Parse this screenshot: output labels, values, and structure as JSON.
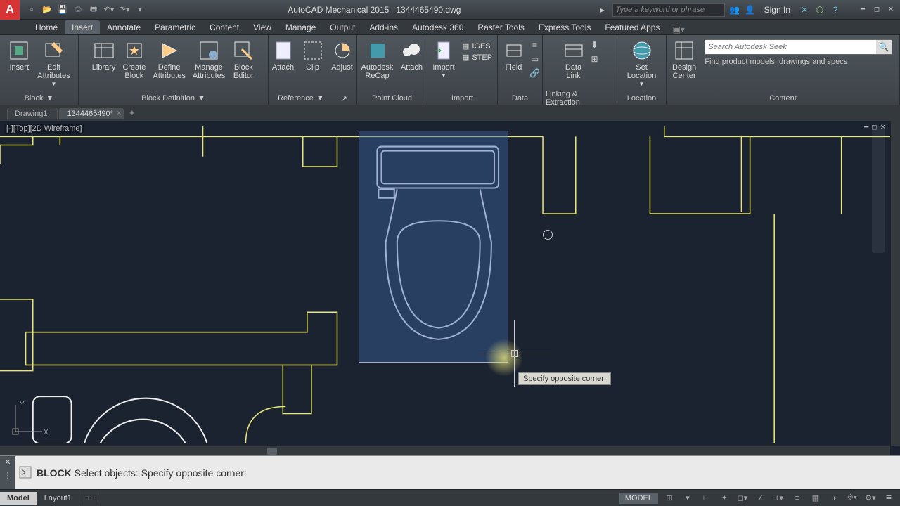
{
  "app": {
    "title_prefix": "AutoCAD Mechanical 2015",
    "filename": "1344465490.dwg"
  },
  "search": {
    "placeholder": "Type a keyword or phrase"
  },
  "signin": {
    "label": "Sign In"
  },
  "tabs": [
    "Home",
    "Insert",
    "Annotate",
    "Parametric",
    "Content",
    "View",
    "Manage",
    "Output",
    "Add-ins",
    "Autodesk 360",
    "Raster Tools",
    "Express Tools",
    "Featured Apps"
  ],
  "tabs_active": 1,
  "ribbon": {
    "panel1": {
      "insert": "Insert",
      "edit_attr": "Edit\nAttributes",
      "title": "Block"
    },
    "panel2": {
      "library": "Library",
      "create": "Create\nBlock",
      "define": "Define\nAttributes",
      "manage": "Manage\nAttributes",
      "editor": "Block\nEditor",
      "title": "Block Definition"
    },
    "panel3": {
      "attach": "Attach",
      "clip": "Clip",
      "adjust": "Adjust",
      "title": "Reference"
    },
    "panel4": {
      "recap": "Autodesk\nReCap",
      "attach": "Attach",
      "title": "Point Cloud"
    },
    "panel5": {
      "import": "Import",
      "iges": "IGES",
      "step": "STEP",
      "title": "Import"
    },
    "panel6": {
      "field": "Field",
      "title": "Data"
    },
    "panel7": {
      "datalink": "Data\nLink",
      "title": "Linking & Extraction"
    },
    "panel8": {
      "setloc": "Set\nLocation",
      "title": "Location"
    },
    "panel9": {
      "design": "Design\nCenter",
      "seek_ph": "Search Autodesk Seek",
      "seek_hint": "Find product models, drawings and specs",
      "title": "Content"
    }
  },
  "doc_tabs": [
    {
      "label": "Drawing1"
    },
    {
      "label": "1344465490*"
    }
  ],
  "doc_tabs_active": 1,
  "viewport": {
    "label": "[-][Top][2D Wireframe]"
  },
  "tooltip": "Specify opposite corner:",
  "cmdline": {
    "cmd": "BLOCK",
    "rest": " Select objects: Specify opposite corner:"
  },
  "layout_tabs": [
    "Model",
    "Layout1"
  ],
  "layout_active": 0,
  "status": {
    "model": "MODEL"
  }
}
